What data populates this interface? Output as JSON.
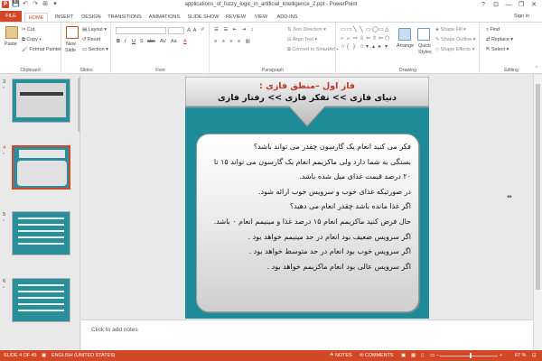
{
  "window": {
    "title": "applications_of_fuzzy_logic_in_artificial_intelligence_2.ppt - PowerPoint",
    "help": "?",
    "minimize": "—",
    "restore": "❐",
    "close": "✕",
    "sign_in": "Sign in"
  },
  "quick_access": {
    "app_icon": "P",
    "save": "💾",
    "undo": "↶",
    "redo": "↷",
    "start": "⊞",
    "more": "▾"
  },
  "tabs": [
    "FILE",
    "HOME",
    "INSERT",
    "DESIGN",
    "TRANSITIONS",
    "ANIMATIONS",
    "SLIDE SHOW",
    "REVIEW",
    "VIEW",
    "ADD-INS"
  ],
  "ribbon": {
    "clipboard": {
      "paste": "Paste",
      "cut": "Cut",
      "copy": "Copy",
      "format_painter": "Format Painter",
      "label": "Clipboard"
    },
    "slides": {
      "new_slide": "New",
      "new_slide_2": "Slide",
      "layout": "Layout",
      "reset": "Reset",
      "section": "Section",
      "label": "Slides"
    },
    "font": {
      "bold": "B",
      "italic": "I",
      "underline": "U",
      "strike": "S",
      "shadow": "abc",
      "spacing": "AV",
      "case": "Aa",
      "grow": "A",
      "shrink": "A",
      "color": "A",
      "label": "Font"
    },
    "paragraph": {
      "text_direction": "Text Direction",
      "align_text": "Align Text",
      "smartart": "Convert to SmartArt",
      "label": "Paragraph"
    },
    "drawing": {
      "arrange": "Arrange",
      "quick_styles": "Quick",
      "quick_styles_2": "Styles",
      "shape_fill": "Shape Fill",
      "shape_outline": "Shape Outline",
      "shape_effects": "Shape Effects",
      "label": "Drawing"
    },
    "editing": {
      "find": "Find",
      "replace": "Replace",
      "select": "Select",
      "label": "Editing"
    }
  },
  "thumbnails": [
    {
      "num": "3",
      "star": "*"
    },
    {
      "num": "4",
      "star": "*"
    },
    {
      "num": "5",
      "star": "*"
    },
    {
      "num": "6",
      "star": "*"
    }
  ],
  "slide": {
    "title": "فاز اول –منطق فازی :",
    "subtitle": "دنیای فازی >> تفکر فازی >> رفتار فازی",
    "lines": [
      "فکر می کنید انعام یک گارسون چقدر می تواند باشد؟",
      "بستگی به شما دارد ولی ماکزیمم انعام یک گارسون می تواند ۱۵ تا",
      "۲۰ درصد قیمت غذای میل شده باشد.",
      "در صورتیکه غذای خوب و سرویس خوب ارائه شود.",
      "اگر غذا مانده باشد چقدر انعام می دهید؟",
      "حال فرض کنید ماکزیمم انعام ۱۵ درصد غذا و مینیمم انعام ۰ باشد.",
      "اگر سرویس ضعیف بود انعام در حد مینیمم خواهد بود .",
      "اگر سرویس خوب بود انعام در حد متوسط خواهد بود .",
      "اگر سرویس عالی بود انعام ماکزیمم خواهد بود ."
    ]
  },
  "notes_placeholder": "Click to add notes",
  "status": {
    "slide": "SLIDE 4 OF 45",
    "language": "ENGLISH (UNITED STATES)",
    "notes": "NOTES",
    "comments": "COMMENTS",
    "zoom": "67 %"
  },
  "colors": {
    "accent": "#d24726",
    "slide_bg": "#1d8c98"
  }
}
